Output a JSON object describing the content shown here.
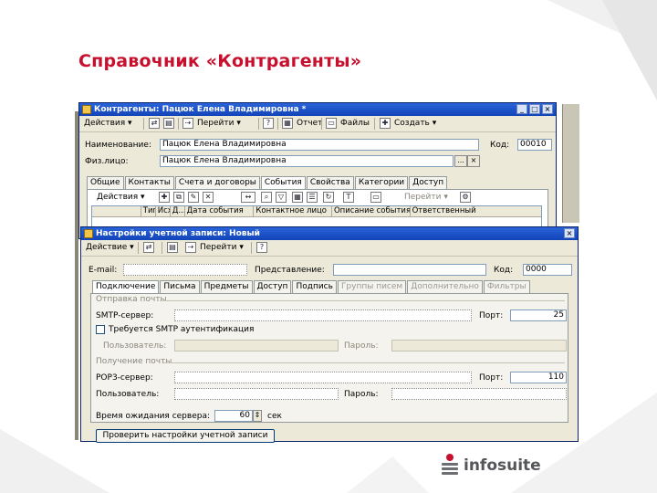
{
  "slide": {
    "title": "Справочник «Контрагенты»"
  },
  "main_window": {
    "title": "Контрагенты: Пацюк Елена Владимировна *",
    "toolbar": {
      "actions": "Действия",
      "goto": "Перейти",
      "report": "Отчет",
      "files": "Файлы",
      "create": "Создать"
    },
    "name_label": "Наименование:",
    "name_value": "Пацюк Елена Владимировна",
    "code_label": "Код:",
    "code_value": "00010",
    "person_label": "Физ.лицо:",
    "person_value": "Пацюк Елена Владимировна",
    "tabs": [
      "Общие",
      "Контакты",
      "Счета и договоры",
      "События",
      "Свойства",
      "Категории",
      "Доступ"
    ],
    "active_tab": "События",
    "events_toolbar": {
      "actions": "Действия",
      "goto": "Перейти"
    },
    "columns": [
      "Тип",
      "Исх",
      "Д...",
      "Дата события",
      "Контактное лицо",
      "Описание события",
      "Ответственный"
    ]
  },
  "dialog": {
    "title": "Настройки учетной записи: Новый",
    "toolbar": {
      "actions": "Действие",
      "goto": "Перейти"
    },
    "email_label": "E-mail:",
    "email_value": "",
    "presentation_label": "Представление:",
    "presentation_value": "",
    "code_label": "Код:",
    "code_value": "0000",
    "tabs": [
      "Подключение",
      "Письма",
      "Предметы",
      "Доступ",
      "Подпись",
      "Группы писем",
      "Дополнительно",
      "Фильтры"
    ],
    "active_tab": "Подключение",
    "disabled_tabs": [
      "Группы писем",
      "Дополнительно",
      "Фильтры"
    ],
    "outgoing_title": "Отправка почты",
    "smtp_label": "SMTP-сервер:",
    "smtp_value": "",
    "smtp_port_label": "Порт:",
    "smtp_port_value": "25",
    "smtp_auth_label": "Требуется SMTP аутентификация",
    "smtp_auth_checked": false,
    "smtp_user_label": "Пользователь:",
    "smtp_password_label": "Пароль:",
    "incoming_title": "Получение почты",
    "pop3_label": "POP3-сервер:",
    "pop3_value": "",
    "pop3_port_label": "Порт:",
    "pop3_port_value": "110",
    "pop3_user_label": "Пользователь:",
    "pop3_user_value": "",
    "pop3_password_label": "Пароль:",
    "pop3_password_value": "",
    "timeout_label": "Время ожидания сервера:",
    "timeout_value": "60",
    "timeout_unit": "сек",
    "check_button": "Проверить настройки учетной записи"
  },
  "logo": {
    "text": "infosuite",
    "color": "#c8102e"
  },
  "icons": {
    "logo_mark": "infosuite-logo-icon"
  },
  "colors": {
    "title_red": "#c8102e",
    "titlebar_blue": "#1f54c4",
    "window_face": "#ece9d8"
  }
}
